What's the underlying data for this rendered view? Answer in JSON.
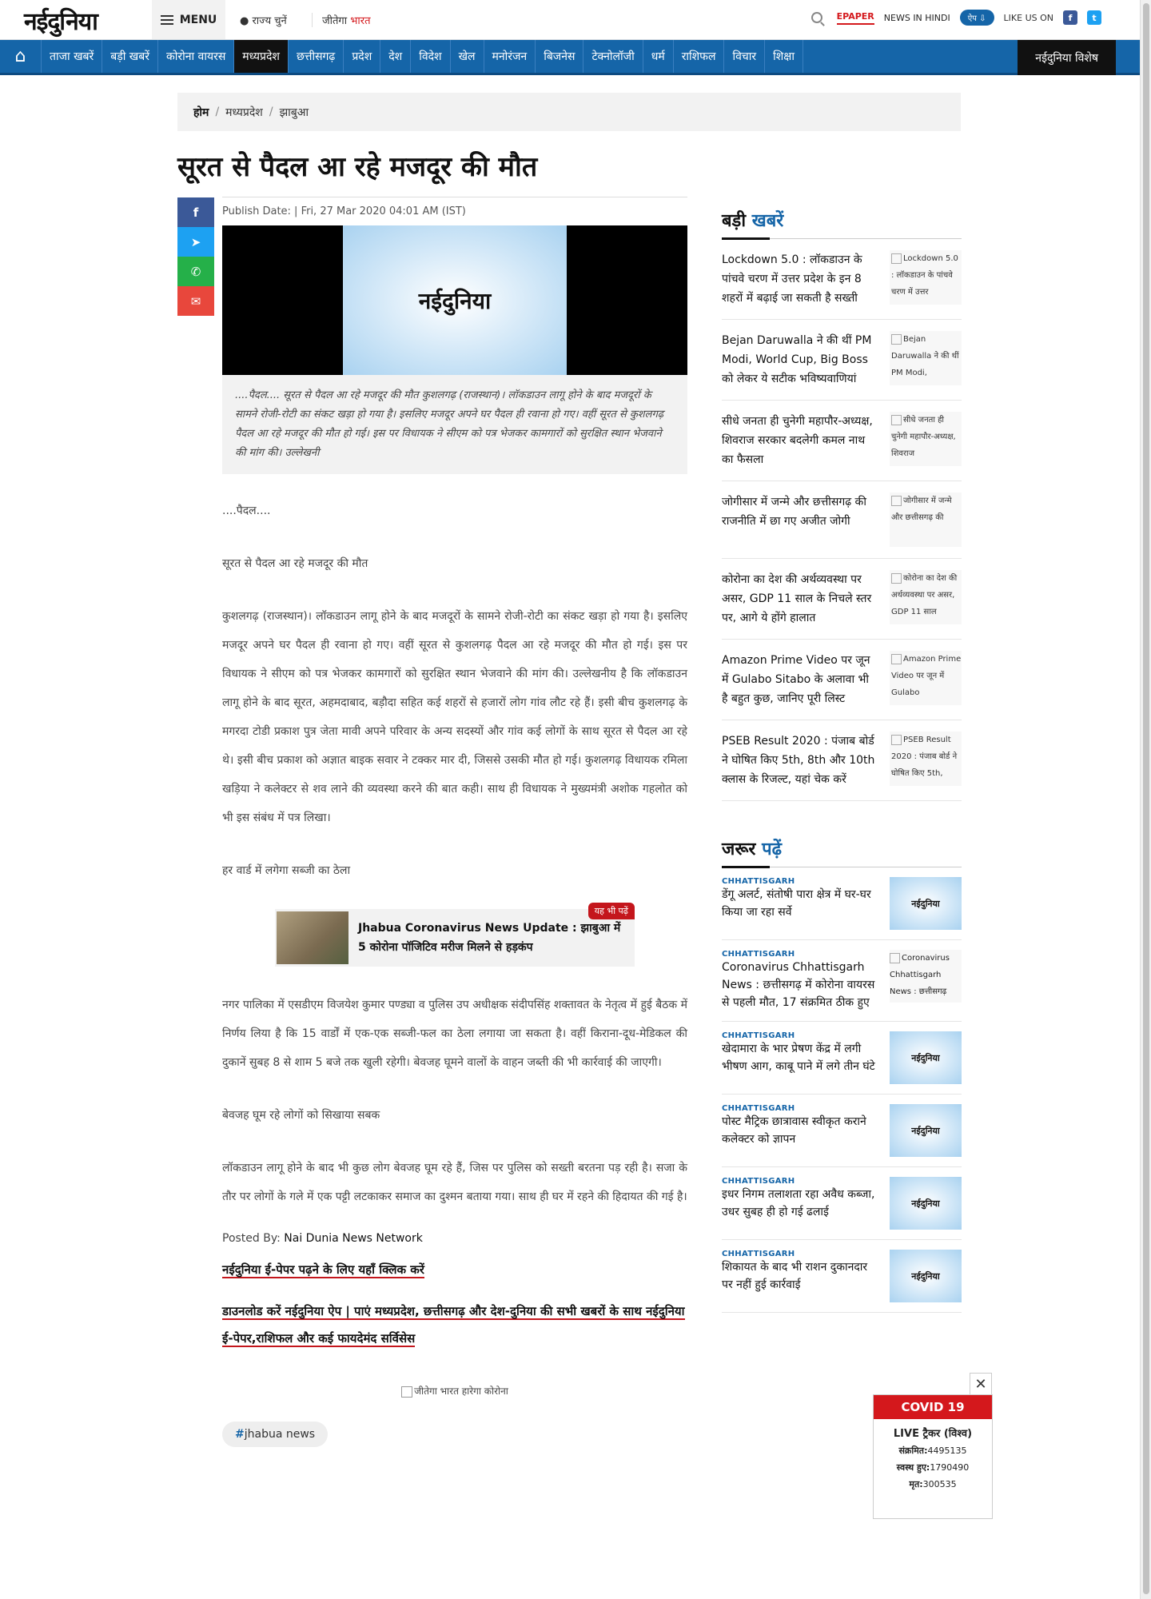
{
  "topbar": {
    "logo": "नईदुनिया",
    "menu_label": "MENU",
    "state_label": "राज्य चुनें",
    "jeetega_prefix": "जीतेगा ",
    "jeetega_highlight": "भारत",
    "epaper": "EPAPER",
    "news_in_hindi": "NEWS IN HINDI",
    "app_label": "ऐप",
    "like_us": "LIKE US ON"
  },
  "nav": {
    "items": [
      "ताजा खबरें",
      "बड़ी खबरें",
      "कोरोना वायरस",
      "मध्यप्रदेश",
      "छत्तीसगढ़",
      "प्रदेश",
      "देश",
      "विदेश",
      "खेल",
      "मनोरंजन",
      "बिजनेस",
      "टेक्नोलॉजी",
      "धर्म",
      "राशिफल",
      "विचार",
      "शिक्षा"
    ],
    "active_index": 3,
    "special": "नईदुनिया विशेष"
  },
  "breadcrumb": {
    "home": "होम",
    "level1": "मध्यप्रदेश",
    "level2": "झाबुआ"
  },
  "article": {
    "title": "सूरत से पैदल आ रहे मजदूर की मौत",
    "publish": "Publish Date: | Fri, 27 Mar 2020 04:01 AM (IST)",
    "hero_logo": "नईदुनिया",
    "caption": "....पैदल.... सूरत से पैदल आ रहे मजदूर की मौत कुशलगढ़ (राजस्थान)। लॉकडाउन लागू होने के बाद मजदूरों के सामने रोजी-रोटी का संकट खड़ा हो गया है। इसलिए मजदूर अपने घर पैदल ही रवाना हो गए। वहीं सूरत से कुशलगढ़ पैदल आ रहे मजदूर की मौत हो गई। इस पर विधायक ने सीएम को पत्र भेजकर कामगारों को सुरक्षित स्थान भेजवाने की मांग की। उल्लेखनी",
    "p1": "....पैदल....",
    "p2": "सूरत से पैदल आ रहे मजदूर की मौत",
    "p3": "कुशलगढ़ (राजस्थान)। लॉकडाउन लागू होने के बाद मजदूरों के सामने रोजी-रोटी का संकट खड़ा हो गया है। इसलिए मजदूर अपने घर पैदल ही रवाना हो गए। वहीं सूरत से कुशलगढ़ पैदल आ रहे मजदूर की मौत हो गई। इस पर विधायक ने सीएम को पत्र भेजकर कामगारों को सुरक्षित स्थान भेजवाने की मांग की। उल्लेखनीय है कि लॉकडाउन लागू होने के बाद सूरत, अहमदाबाद, बड़ौदा सहित कई शहरों से हजारों लोग गांव लौट रहे हैं। इसी बीच कुशलगढ़ के मगरदा टोडी प्रकाश पुत्र जेता मावी अपने परिवार के अन्य सदस्यों और गांव कई लोगों के साथ सूरत से पैदल आ रहे थे। इसी बीच प्रकाश को अज्ञात बाइक सवार ने टक्कर मार दी, जिससे उसकी मौत हो गई। कुशलगढ़ विधायक रमिला खड़िया ने कलेक्टर से शव लाने की व्यवस्था करने की बात कही। साथ ही विधायक ने मुख्यमंत्री अशोक गहलोत को भी इस संबंध में पत्र लिखा।",
    "p4": "हर वार्ड में लगेगा सब्जी का ठेला",
    "read_also_tag": "यह भी पढ़ें",
    "read_also_text": "Jhabua Coronavirus News Update : झाबुआ में 5 कोरोना पॉजिटिव मरीज मिलने से हड़कंप",
    "p5": "नगर पालिका में एसडीएम विजयेश कुमार पण्ड्या व पुलिस उप अधीक्षक संदीपसिंह शक्तावत के नेतृत्व में हुई बैठक में निर्णय लिया है कि 15 वार्डों में एक-एक सब्जी-फल का ठेला लगाया जा सकता है। वहीं किराना-दूध-मेडिकल की दुकानें सुबह 8 से शाम 5 बजे तक खुली रहेगी। बेवजह घूमने वालों के वाहन जब्ती की भी कार्रवाई की जाएगी।",
    "p6": "बेवजह घूम रहे लोगों को सिखाया सबक",
    "p7": "लॉकडाउन लागू होने के बाद भी कुछ लोग बेवजह घूम रहे हैं, जिस पर पुलिस को सख्ती बरतना पड़ रही है। सजा के तौर पर लोगों के गले में एक पट्टी लटकाकर समाज का दुश्मन बताया गया। साथ ही घर में रहने की हिदायत की गई है।",
    "posted_by_label": "Posted By: ",
    "posted_by": "Nai Dunia News Network",
    "link1": "नईदुनिया ई-पेपर पढ़ने के लिए यहाँ क्लिक करें",
    "link2": "डाउनलोड करें नईदुनिया ऐप | पाएं मध्यप्रदेश, छत्तीसगढ़ और देश-दुनिया की सभी खबरों के साथ नईदुनिया ई-पेपर,राशिफल और कई फायदेमंद सर्विसेस",
    "img_alt": "जीतेगा भारत हारेगा कोरोना",
    "hashtag": "jhabua news"
  },
  "sidebar": {
    "badi_head_black": "बड़ी ",
    "badi_head_blue": "खबरें",
    "badi_items": [
      {
        "title": "Lockdown 5.0 : लॉकडाउन के पांचवे चरण में उत्तर प्रदेश के इन 8 शहरों में बढ़ाई जा सकती है सख्ती",
        "alt": "Lockdown 5.0 : लॉकडाउन के पांचवे चरण में उत्तर"
      },
      {
        "title": "Bejan Daruwalla ने की थीं PM Modi, World Cup, Big Boss को लेकर ये सटीक भविष्यवाणियां",
        "alt": "Bejan Daruwalla ने की थीं PM Modi,"
      },
      {
        "title": "सीधे जनता ही चुनेगी महापौर-अध्यक्ष, शिवराज सरकार बदलेगी कमल नाथ का फैसला",
        "alt": "सीधे जनता ही चुनेगी महापौर-अध्यक्ष, शिवराज"
      },
      {
        "title": "जोगीसार में जन्मे और छत्तीसगढ़ की राजनीति में छा गए अजीत जोगी",
        "alt": "जोगीसार में जन्मे और छत्तीसगढ़ की"
      },
      {
        "title": "कोरोना का देश की अर्थव्यवस्था पर असर, GDP 11 साल के निचले स्तर पर, आगे ये होंगे हालात",
        "alt": "कोरोना का देश की अर्थव्यवस्था पर असर, GDP 11 साल"
      },
      {
        "title": "Amazon Prime Video पर जून में Gulabo Sitabo के अलावा भी है बहुत कुछ, जानिए पूरी लिस्ट",
        "alt": "Amazon Prime Video पर जून में Gulabo"
      },
      {
        "title": "PSEB Result 2020 : पंजाब बोर्ड ने घोषित किए 5th, 8th और 10th क्लास के रिजल्ट, यहां चेक करें",
        "alt": "PSEB Result 2020 : पंजाब बोर्ड ने घोषित किए 5th,"
      }
    ],
    "jaroor_head_black": "जरूर ",
    "jaroor_head_blue": "पढ़ें",
    "jaroor_items": [
      {
        "cat": "CHHATTISGARH",
        "title": "डेंगू अलर्ट, संतोषी पारा क्षेत्र में घर-घर किया जा रहा सर्वे",
        "thumb": "नईदुनिया"
      },
      {
        "cat": "CHHATTISGARH",
        "title": "Coronavirus Chhattisgarh News : छत्तीसगढ़ में कोरोना वायरस से पहली मौत, 17 संक्रमित ठीक हुए",
        "alt": "Coronavirus Chhattisgarh News : छत्तीसगढ़"
      },
      {
        "cat": "CHHATTISGARH",
        "title": "खेदामारा के भार प्रेषण केंद्र में लगी भीषण आग, काबू पाने में लगे तीन घंटे",
        "thumb": "नईदुनिया"
      },
      {
        "cat": "CHHATTISGARH",
        "title": "पोस्ट मैट्रिक छात्रावास स्वीकृत कराने कलेक्टर को ज्ञापन",
        "thumb": "नईदुनिया"
      },
      {
        "cat": "CHHATTISGARH",
        "title": "इधर निगम तलाशता रहा अवैध कब्जा, उधर सुबह ही हो गई ढलाई",
        "thumb": "नईदुनिया"
      },
      {
        "cat": "CHHATTISGARH",
        "title": "शिकायत के बाद भी राशन दुकानदार पर नहीं हुई कार्रवाई",
        "thumb": "नईदुनिया"
      }
    ]
  },
  "covid": {
    "close": "✕",
    "title": "COVID 19",
    "subtitle": "LIVE ट्रैकर (विश्व)",
    "infected_label": "संक्रमित:",
    "infected": "4495135",
    "recovered_label": "स्वस्थ हुए:",
    "recovered": "1790490",
    "deaths_label": "मृत:",
    "deaths": "300535"
  }
}
